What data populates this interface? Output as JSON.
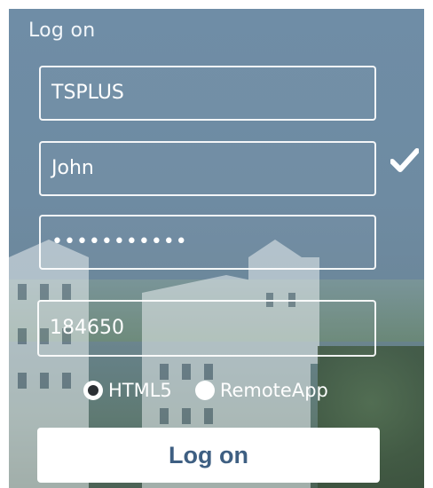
{
  "title": "Log on",
  "fields": {
    "server": "TSPLUS",
    "username": "John",
    "password": "•••••••••••",
    "code": "184650"
  },
  "icons": {
    "validation": "checkmark-icon"
  },
  "radios": [
    {
      "label": "HTML5",
      "checked": true
    },
    {
      "label": "RemoteApp",
      "checked": false
    }
  ],
  "logon_button": "Log on",
  "colors": {
    "button_text": "#3e5f82",
    "field_border": "#ffffff"
  }
}
